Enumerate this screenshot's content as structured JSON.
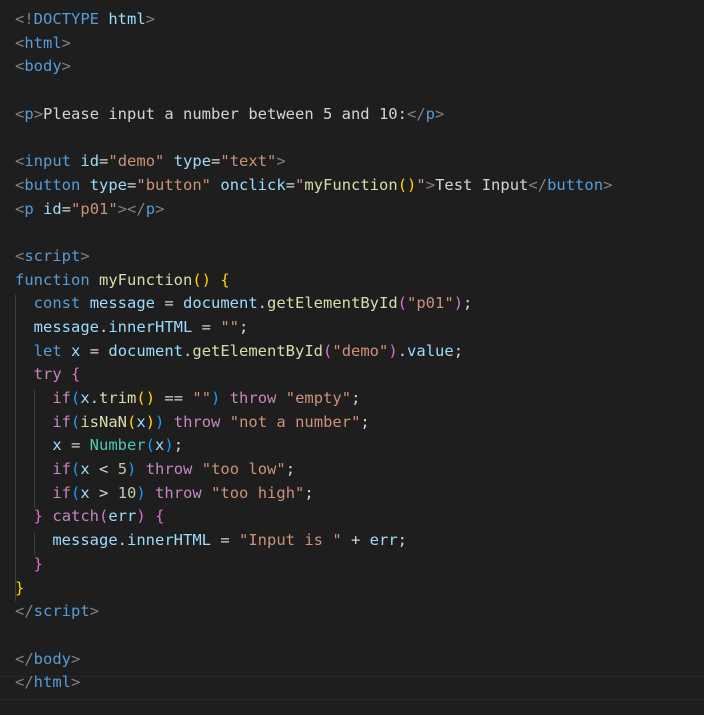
{
  "editor": {
    "language": "html",
    "theme": "dark",
    "colors": {
      "background": "#1e1e1e",
      "tag_bracket": "#808080",
      "tag_name": "#569cd6",
      "attribute": "#9cdcfe",
      "string": "#ce9178",
      "keyword": "#569cd6",
      "control": "#c586c0",
      "function": "#dcdcaa",
      "variable": "#9cdcfe",
      "number": "#b5cea8",
      "type": "#4ec9b0",
      "bracket_1": "#ffd700",
      "bracket_2": "#da70d6",
      "bracket_3": "#179fff"
    },
    "lines": [
      [
        [
          "tg",
          "<!"
        ],
        [
          "tn",
          "DOCTYPE"
        ],
        [
          "tx",
          " "
        ],
        [
          "at",
          "html"
        ],
        [
          "tg",
          ">"
        ]
      ],
      [
        [
          "tg",
          "<"
        ],
        [
          "tn",
          "html"
        ],
        [
          "tg",
          ">"
        ]
      ],
      [
        [
          "tg",
          "<"
        ],
        [
          "tn",
          "body"
        ],
        [
          "tg",
          ">"
        ]
      ],
      [],
      [
        [
          "tg",
          "<"
        ],
        [
          "tn",
          "p"
        ],
        [
          "tg",
          ">"
        ],
        [
          "tx",
          "Please input a number between 5 and 10:"
        ],
        [
          "tg",
          "</"
        ],
        [
          "tn",
          "p"
        ],
        [
          "tg",
          ">"
        ]
      ],
      [],
      [
        [
          "tg",
          "<"
        ],
        [
          "tn",
          "input"
        ],
        [
          "tx",
          " "
        ],
        [
          "at",
          "id"
        ],
        [
          "tx",
          "="
        ],
        [
          "st",
          "\"demo\""
        ],
        [
          "tx",
          " "
        ],
        [
          "at",
          "type"
        ],
        [
          "tx",
          "="
        ],
        [
          "st",
          "\"text\""
        ],
        [
          "tg",
          ">"
        ]
      ],
      [
        [
          "tg",
          "<"
        ],
        [
          "tn",
          "button"
        ],
        [
          "tx",
          " "
        ],
        [
          "at",
          "type"
        ],
        [
          "tx",
          "="
        ],
        [
          "st",
          "\"button\""
        ],
        [
          "tx",
          " "
        ],
        [
          "at",
          "onclick"
        ],
        [
          "tx",
          "="
        ],
        [
          "st",
          "\""
        ],
        [
          "fn",
          "myFunction"
        ],
        [
          "b1",
          "()"
        ],
        [
          "st",
          "\""
        ],
        [
          "tg",
          ">"
        ],
        [
          "tx",
          "Test Input"
        ],
        [
          "tg",
          "</"
        ],
        [
          "tn",
          "button"
        ],
        [
          "tg",
          ">"
        ]
      ],
      [
        [
          "tg",
          "<"
        ],
        [
          "tn",
          "p"
        ],
        [
          "tx",
          " "
        ],
        [
          "at",
          "id"
        ],
        [
          "tx",
          "="
        ],
        [
          "st",
          "\"p01\""
        ],
        [
          "tg",
          "></"
        ],
        [
          "tn",
          "p"
        ],
        [
          "tg",
          ">"
        ]
      ],
      [],
      [
        [
          "tg",
          "<"
        ],
        [
          "tn",
          "script"
        ],
        [
          "tg",
          ">"
        ]
      ],
      [
        [
          "kw",
          "function"
        ],
        [
          "tx",
          " "
        ],
        [
          "fn",
          "myFunction"
        ],
        [
          "b1",
          "()"
        ],
        [
          "tx",
          " "
        ],
        [
          "b1",
          "{"
        ]
      ],
      [
        [
          "tx",
          "  "
        ],
        [
          "kw",
          "const"
        ],
        [
          "tx",
          " "
        ],
        [
          "vr",
          "message"
        ],
        [
          "tx",
          " = "
        ],
        [
          "vr",
          "document"
        ],
        [
          "tx",
          "."
        ],
        [
          "fn",
          "getElementById"
        ],
        [
          "b2",
          "("
        ],
        [
          "st",
          "\"p01\""
        ],
        [
          "b2",
          ")"
        ],
        [
          "tx",
          ";"
        ]
      ],
      [
        [
          "tx",
          "  "
        ],
        [
          "vr",
          "message"
        ],
        [
          "tx",
          "."
        ],
        [
          "vr",
          "innerHTML"
        ],
        [
          "tx",
          " = "
        ],
        [
          "st",
          "\"\""
        ],
        [
          "tx",
          ";"
        ]
      ],
      [
        [
          "tx",
          "  "
        ],
        [
          "kw",
          "let"
        ],
        [
          "tx",
          " "
        ],
        [
          "vr",
          "x"
        ],
        [
          "tx",
          " = "
        ],
        [
          "vr",
          "document"
        ],
        [
          "tx",
          "."
        ],
        [
          "fn",
          "getElementById"
        ],
        [
          "b2",
          "("
        ],
        [
          "st",
          "\"demo\""
        ],
        [
          "b2",
          ")"
        ],
        [
          "tx",
          "."
        ],
        [
          "vr",
          "value"
        ],
        [
          "tx",
          ";"
        ]
      ],
      [
        [
          "tx",
          "  "
        ],
        [
          "ct",
          "try"
        ],
        [
          "tx",
          " "
        ],
        [
          "b2",
          "{"
        ]
      ],
      [
        [
          "tx",
          "    "
        ],
        [
          "ct",
          "if"
        ],
        [
          "b3",
          "("
        ],
        [
          "vr",
          "x"
        ],
        [
          "tx",
          "."
        ],
        [
          "fn",
          "trim"
        ],
        [
          "b1",
          "()"
        ],
        [
          "tx",
          " == "
        ],
        [
          "st",
          "\"\""
        ],
        [
          "b3",
          ")"
        ],
        [
          "tx",
          " "
        ],
        [
          "ct",
          "throw"
        ],
        [
          "tx",
          " "
        ],
        [
          "st",
          "\"empty\""
        ],
        [
          "tx",
          ";"
        ]
      ],
      [
        [
          "tx",
          "    "
        ],
        [
          "ct",
          "if"
        ],
        [
          "b3",
          "("
        ],
        [
          "fn",
          "isNaN"
        ],
        [
          "b1",
          "("
        ],
        [
          "vr",
          "x"
        ],
        [
          "b1",
          ")"
        ],
        [
          "b3",
          ")"
        ],
        [
          "tx",
          " "
        ],
        [
          "ct",
          "throw"
        ],
        [
          "tx",
          " "
        ],
        [
          "st",
          "\"not a number\""
        ],
        [
          "tx",
          ";"
        ]
      ],
      [
        [
          "tx",
          "    "
        ],
        [
          "vr",
          "x"
        ],
        [
          "tx",
          " = "
        ],
        [
          "ty",
          "Number"
        ],
        [
          "b3",
          "("
        ],
        [
          "vr",
          "x"
        ],
        [
          "b3",
          ")"
        ],
        [
          "tx",
          ";"
        ]
      ],
      [
        [
          "tx",
          "    "
        ],
        [
          "ct",
          "if"
        ],
        [
          "b3",
          "("
        ],
        [
          "vr",
          "x"
        ],
        [
          "tx",
          " < "
        ],
        [
          "nm",
          "5"
        ],
        [
          "b3",
          ")"
        ],
        [
          "tx",
          " "
        ],
        [
          "ct",
          "throw"
        ],
        [
          "tx",
          " "
        ],
        [
          "st",
          "\"too low\""
        ],
        [
          "tx",
          ";"
        ]
      ],
      [
        [
          "tx",
          "    "
        ],
        [
          "ct",
          "if"
        ],
        [
          "b3",
          "("
        ],
        [
          "vr",
          "x"
        ],
        [
          "tx",
          " > "
        ],
        [
          "nm",
          "10"
        ],
        [
          "b3",
          ")"
        ],
        [
          "tx",
          " "
        ],
        [
          "ct",
          "throw"
        ],
        [
          "tx",
          " "
        ],
        [
          "st",
          "\"too high\""
        ],
        [
          "tx",
          ";"
        ]
      ],
      [
        [
          "tx",
          "  "
        ],
        [
          "b2",
          "}"
        ],
        [
          "tx",
          " "
        ],
        [
          "ct",
          "catch"
        ],
        [
          "b2",
          "("
        ],
        [
          "vr",
          "err"
        ],
        [
          "b2",
          ")"
        ],
        [
          "tx",
          " "
        ],
        [
          "b2",
          "{"
        ]
      ],
      [
        [
          "tx",
          "    "
        ],
        [
          "vr",
          "message"
        ],
        [
          "tx",
          "."
        ],
        [
          "vr",
          "innerHTML"
        ],
        [
          "tx",
          " = "
        ],
        [
          "st",
          "\"Input is \""
        ],
        [
          "tx",
          " + "
        ],
        [
          "vr",
          "err"
        ],
        [
          "tx",
          ";"
        ]
      ],
      [
        [
          "tx",
          "  "
        ],
        [
          "b2",
          "}"
        ]
      ],
      [
        [
          "b1",
          "}"
        ]
      ],
      [
        [
          "tg",
          "</"
        ],
        [
          "tn",
          "script"
        ],
        [
          "tg",
          ">"
        ]
      ],
      [],
      [
        [
          "tg",
          "</"
        ],
        [
          "tn",
          "body"
        ],
        [
          "tg",
          ">"
        ]
      ],
      [
        [
          "tg",
          "</"
        ],
        [
          "tn",
          "html"
        ],
        [
          "tg",
          ">"
        ]
      ]
    ]
  }
}
